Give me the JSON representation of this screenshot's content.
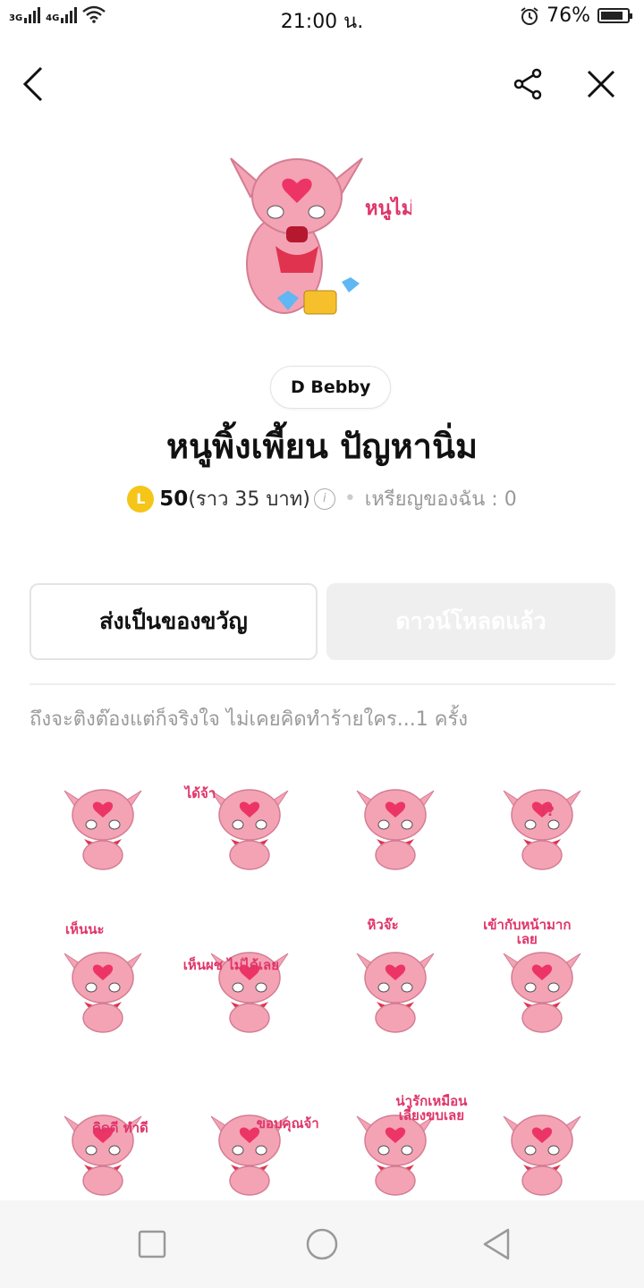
{
  "status_bar": {
    "network": "3G 4G",
    "time": "21:00 น.",
    "battery": "76%",
    "battery_level": 0.76
  },
  "top_bar": {
    "back_icon": "chevron-left-icon",
    "share_icon": "share-icon",
    "close_icon": "close-icon"
  },
  "hero": {
    "caption": "หนูไม่มีเงิน"
  },
  "author": "D Bebby",
  "title": "หนูพิ้งเพี้ยน ปัญหานิ่ม",
  "price": {
    "coin_letter": "L",
    "amount": "50",
    "baht": "(ราว 35 บาท)",
    "my_coins": "เหรียญของฉัน : 0"
  },
  "buttons": {
    "gift": "ส่งเป็นของขวัญ",
    "downloaded": "ดาวน์โหลดแล้ว"
  },
  "description": "ถึงจะติงต๊องแต่ก็จริงใจ ไม่เคยคิดทำร้ายใคร...1 ครั้ง",
  "stickers": [
    {
      "caption": ""
    },
    {
      "caption": "ได้จ้า"
    },
    {
      "caption": ""
    },
    {
      "caption": "!?"
    },
    {
      "caption": "เห็นนะ"
    },
    {
      "caption": "เห็นผช ไม่ได้เลย"
    },
    {
      "caption": "หิวจ๊ะ"
    },
    {
      "caption": "เข้ากับหน้ามากเลย"
    },
    {
      "caption": "คิดดี ทำดี"
    },
    {
      "caption": "ขอบคุณจ้า"
    },
    {
      "caption": "น่ารักเหมือน เลี้ยงขบเลย"
    },
    {
      "caption": ""
    }
  ],
  "nav_bar": {
    "recent_icon": "square-icon",
    "home_icon": "circle-icon",
    "back_icon": "triangle-back-icon"
  },
  "colors": {
    "accent_pink": "#f78fa7",
    "coin_yellow": "#f5c518",
    "caption_pink": "#e0356a"
  }
}
